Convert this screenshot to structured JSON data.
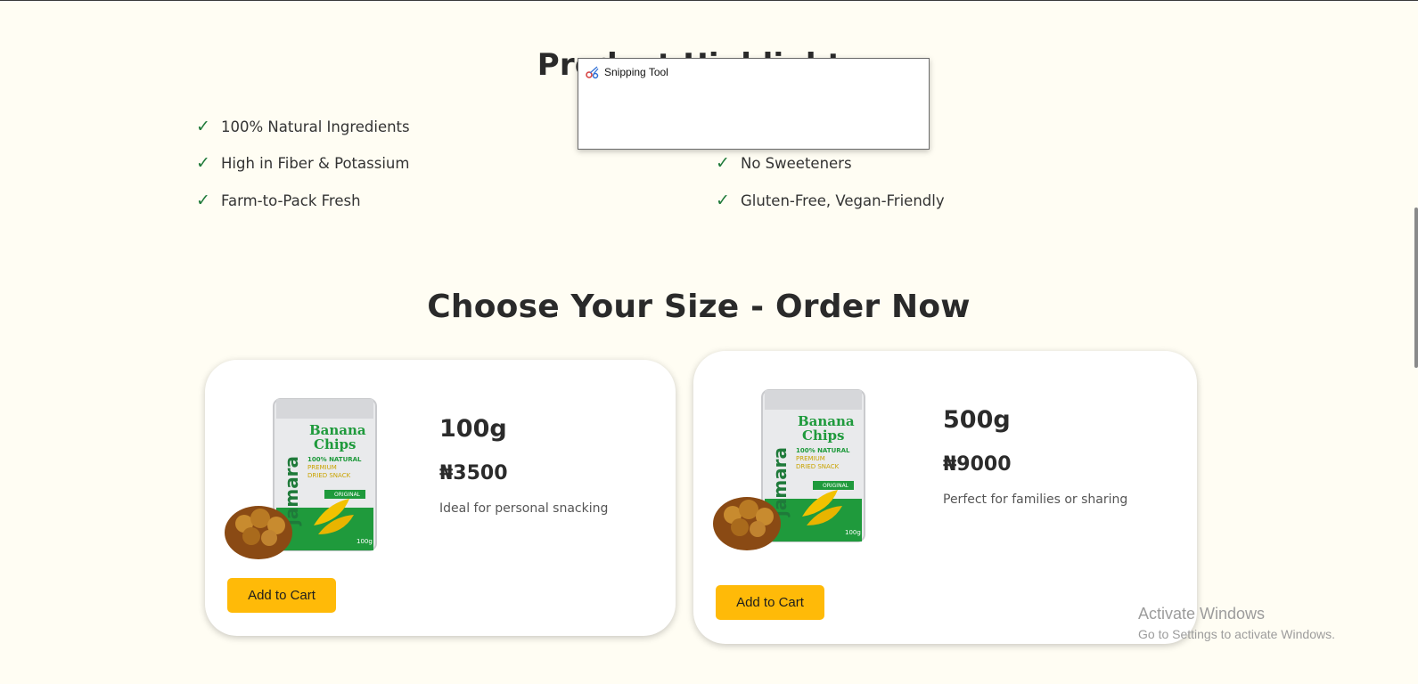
{
  "highlights": {
    "title": "Product Highlights",
    "features": [
      "100% Natural Ingredients",
      "High in Fiber & Potassium",
      "Farm-to-Pack Fresh",
      "No Sweeteners",
      "Gluten-Free, Vegan-Friendly"
    ],
    "check_glyph": "✓"
  },
  "order": {
    "title": "Choose Your Size - Order Now",
    "products": [
      {
        "size": "100g",
        "price": "₦3500",
        "description": "Ideal for personal snacking",
        "button_label": "Add to Cart"
      },
      {
        "size": "500g",
        "price": "₦9000",
        "description": "Perfect for families or sharing",
        "button_label": "Add to Cart"
      }
    ]
  },
  "package_art": {
    "brand": "jamara",
    "product_name_1": "Banana",
    "product_name_2": "Chips",
    "tag_1": "100% NATURAL",
    "tag_2": "PREMIUM",
    "tag_3": "DRIED SNACK",
    "badge": "ORIGINAL",
    "weight": "100g"
  },
  "overlay": {
    "snipping_tool_title": "Snipping Tool",
    "activate_title": "Activate Windows",
    "activate_subtitle": "Go to Settings to activate Windows."
  },
  "colors": {
    "background": "#fffdf3",
    "accent_button": "#ffba08",
    "check_green": "#1f7a3a",
    "package_green": "#1f9a3c"
  }
}
